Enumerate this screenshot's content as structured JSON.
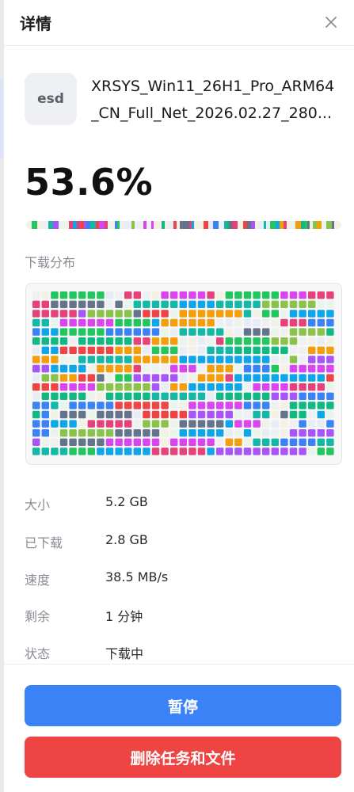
{
  "panel": {
    "title": "详情",
    "close_icon": "close-icon"
  },
  "file": {
    "ext": "esd",
    "name_line1": "XRSYS_Win11_26H1_Pro_ARM64",
    "name_line2": "_CN_Full_Net_2026.02.27_280..."
  },
  "progress": {
    "percent_text": "53.6%",
    "value": 0.536
  },
  "distribution": {
    "label": "下载分布",
    "columns": 33,
    "rows": 18,
    "palette": [
      "#e6427a",
      "#3b82f6",
      "#22c55e",
      "#a855f7",
      "#f59e0b",
      "#0ea5e9",
      "#14b8a6",
      "#ef4444",
      "#8bc34a",
      "#64748b",
      "#10b981",
      "#d946ef"
    ],
    "empty_colors": [
      "#e7ecf5",
      "#eaf4ea",
      "#f3f0e4",
      "#eef0f3"
    ]
  },
  "info": [
    {
      "key": "大小",
      "value": "5.2 GB"
    },
    {
      "key": "已下载",
      "value": "2.8 GB"
    },
    {
      "key": "速度",
      "value": "38.5 MB/s"
    },
    {
      "key": "剩余",
      "value": "1 分钟"
    },
    {
      "key": "状态",
      "value": "下载中"
    }
  ],
  "actions": {
    "pause_label": "暂停",
    "delete_label": "删除任务和文件"
  },
  "colors": {
    "primary": "#3b82f6",
    "danger": "#ef4444"
  }
}
